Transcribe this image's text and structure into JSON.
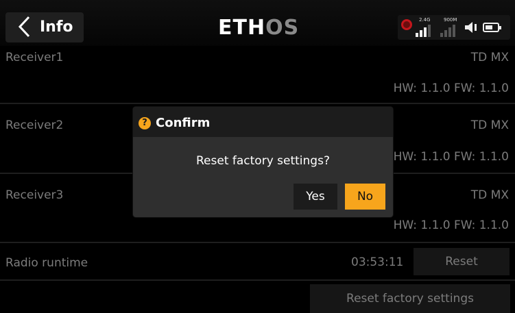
{
  "header": {
    "title": "Info",
    "logo_left": "ETH",
    "logo_right": "OS",
    "signal1_label": "2.4G",
    "signal2_label": "900M"
  },
  "receivers": [
    {
      "label": "Receiver1",
      "model": "TD MX",
      "version": "HW: 1.1.0 FW: 1.1.0"
    },
    {
      "label": "Receiver2",
      "model": "TD MX",
      "version": "HW: 1.1.0 FW: 1.1.0"
    },
    {
      "label": "Receiver3",
      "model": "TD MX",
      "version": "HW: 1.1.0 FW: 1.1.0"
    }
  ],
  "runtime": {
    "label": "Radio runtime",
    "value": "03:53:11",
    "reset_label": "Reset"
  },
  "factory_reset_label": "Reset factory settings",
  "dialog": {
    "icon_glyph": "?",
    "title": "Confirm",
    "message": "Reset factory settings?",
    "yes_label": "Yes",
    "no_label": "No"
  },
  "colors": {
    "accent": "#f7a51c",
    "record": "#c4161c"
  },
  "icons": [
    "back-chevron-icon",
    "record-icon",
    "signal-bars-icon",
    "speaker-icon",
    "battery-icon",
    "question-icon"
  ]
}
